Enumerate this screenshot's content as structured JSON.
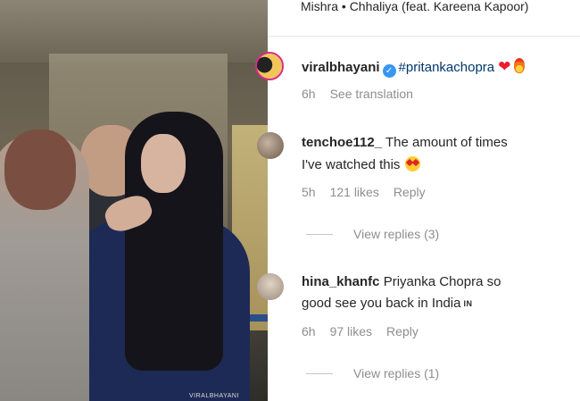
{
  "music_line": "Mishra • Chhaliya (feat. Kareena Kapoor)",
  "video": {
    "watermark": "VIRALBHAYANI"
  },
  "caption": {
    "username": "viralbhayani",
    "hashtag": "#pritankachopra",
    "time": "6h",
    "see_translation": "See translation"
  },
  "comments": [
    {
      "username": "tenchoe112_",
      "text_line1": "The amount of times",
      "text_line2": "I've watched this",
      "time": "5h",
      "likes": "121 likes",
      "reply": "Reply",
      "view_replies": "View replies (3)"
    },
    {
      "username": "hina_khanfc",
      "text_line1": "Priyanka Chopra so",
      "text_line2": "good see you back in India",
      "flag_text": "IN",
      "time": "6h",
      "likes": "97 likes",
      "reply": "Reply",
      "view_replies": "View replies (1)"
    }
  ],
  "colors": {
    "link_blue": "#00376b",
    "verified_blue": "#3897f0",
    "meta_gray": "#8e8e8e"
  }
}
